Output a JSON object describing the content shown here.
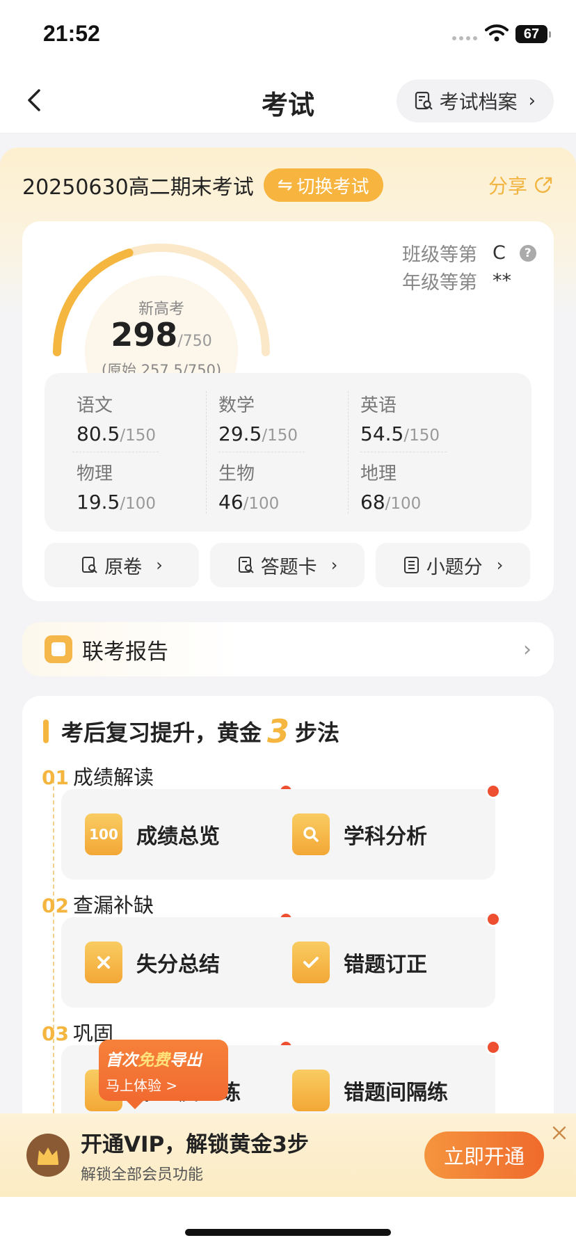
{
  "status": {
    "time": "21:52",
    "battery": "67"
  },
  "nav": {
    "title": "考试",
    "archive_label": "考试档案"
  },
  "exam": {
    "name": "20250630高二期末考试",
    "switch_label": "切换考试",
    "share_label": "分享"
  },
  "score": {
    "label": "新高考",
    "value": "298",
    "total": "/750",
    "original": "(原始 257.5/750)",
    "progress_fraction": 0.4,
    "class_rank_label": "班级等第",
    "class_rank_value": "C",
    "grade_rank_label": "年级等第",
    "grade_rank_value": "**"
  },
  "subjects": [
    {
      "name": "语文",
      "score": "80.5",
      "total": "/150"
    },
    {
      "name": "数学",
      "score": "29.5",
      "total": "/150"
    },
    {
      "name": "英语",
      "score": "54.5",
      "total": "/150"
    },
    {
      "name": "物理",
      "score": "19.5",
      "total": "/100"
    },
    {
      "name": "生物",
      "score": "46",
      "total": "/100"
    },
    {
      "name": "地理",
      "score": "68",
      "total": "/100"
    }
  ],
  "actions": [
    {
      "label": "原卷",
      "icon": "paper-search-icon"
    },
    {
      "label": "答题卡",
      "icon": "answer-sheet-icon"
    },
    {
      "label": "小题分",
      "icon": "list-icon"
    }
  ],
  "joint_report": {
    "label": "联考报告"
  },
  "steps": {
    "title_prefix": "考后复习提升，黄金",
    "title_num": "3",
    "title_suffix": "步法",
    "stages": [
      {
        "num": "01",
        "label": "成绩解读",
        "tiles": [
          "成绩总览",
          "学科分析"
        ]
      },
      {
        "num": "02",
        "label": "查漏补缺",
        "tiles": [
          "失分总结",
          "错题订正"
        ]
      },
      {
        "num": "03",
        "label": "巩固",
        "tiles": [
          "举一反三练",
          "错题间隔练"
        ]
      }
    ],
    "promo_line1_a": "首次",
    "promo_line1_b": "免费",
    "promo_line1_c": "导出",
    "promo_line2": "马上体验 >"
  },
  "vip": {
    "title": "开通VIP，解锁黄金3步",
    "subtitle": "解锁全部会员功能",
    "button": "立即开通"
  },
  "colors": {
    "accent": "#f5b640",
    "badge": "#ee4f30",
    "vip_button": "#ef6a2c"
  }
}
